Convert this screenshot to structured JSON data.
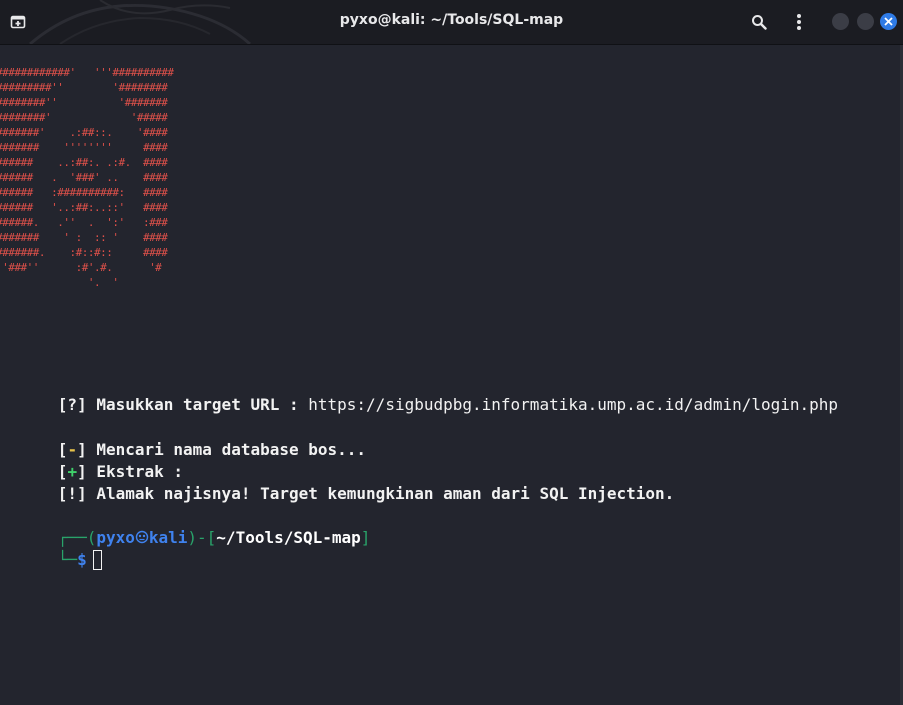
{
  "window": {
    "title": "pyxo@kali: ~/Tools/SQL-map",
    "icons": {
      "new_tab": "new-tab-icon",
      "search": "search-icon",
      "menu": "kebab-menu-icon",
      "minimize": "minimize-icon",
      "maximize": "maximize-icon",
      "close": "close-icon"
    },
    "accent_color": "#2f7be6"
  },
  "terminal": {
    "ascii_color": "#e0514a",
    "ascii_art": [
      "############'   '''##########",
      "#########''        '########",
      "########''          '#######",
      "########'             '#####",
      "#######'    .:##::.    '####",
      "#######    ''''''''     ####",
      "######    ..:##:. .:#.  ####",
      "######   .  '###' ..    ####",
      "######   :##########:   ####",
      "######   '..:##:..::'   ####",
      "######.   .''  .  ':'   :###",
      "#######    ' :  :: '    ####",
      "#######.    :#::#::     ####",
      "''###''      :#'.#.      '#",
      "               '.  '"
    ],
    "lines": {
      "input_prefix": "[?] ",
      "input_label": "Masukkan target URL : ",
      "input_value": "https://sigbudpbg.informatika.ump.ac.id/admin/login.php",
      "search_open": "[",
      "search_sym": "-",
      "search_close": "] ",
      "search_text": "Mencari nama database bos...",
      "extract_open": "[",
      "extract_sym": "+",
      "extract_close": "] ",
      "extract_text": "Ekstrak :",
      "result_prefix": "[!] ",
      "result_text": "Alamak najisnya! Target kemungkinan aman dari SQL Injection."
    },
    "prompt": {
      "corner_top": "┌──(",
      "user": "pyxo",
      "host": "kali",
      "mid": ")-[",
      "path": "~/Tools/SQL-map",
      "end": "]",
      "corner_bottom": "└─",
      "symbol": "$"
    },
    "colors": {
      "background": "#23252e",
      "minus": "#e5c14a",
      "plus": "#3fd16a",
      "prompt_frame": "#29a36a",
      "prompt_user": "#3f82ee"
    }
  }
}
